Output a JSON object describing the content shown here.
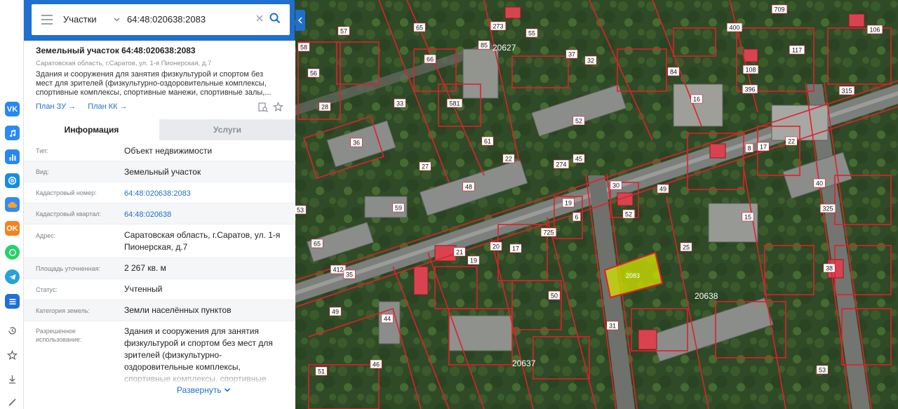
{
  "search": {
    "mode": "Участки",
    "query": "64:48:020638:2083"
  },
  "parcel": {
    "title": "Земельный участок 64:48:020638:2083",
    "address_short": "Саратовская область, г.Саратов, ул. 1-я Пионерская, д.7",
    "usage_short": "Здания и сооружения для занятия физкультурой и спортом без мест для зрителей (физкультурно-оздоровительные комплексы, спортивные комплексы, спортивные манежи, спортивные залы,...",
    "link_zu": "План ЗУ →",
    "link_kk": "План КК →"
  },
  "tabs": {
    "info": "Информация",
    "services": "Услуги"
  },
  "info": {
    "type_label": "Тип:",
    "type_value": "Объект недвижимости",
    "kind_label": "Вид:",
    "kind_value": "Земельный участок",
    "cad_num_label": "Кадастровый номер:",
    "cad_num_value": "64:48:020638:2083",
    "cad_block_label": "Кадастровый квартал:",
    "cad_block_value": "64:48:020638",
    "address_label": "Адрес:",
    "address_value": "Саратовская область, г.Саратов, ул. 1-я Пионерская, д.7",
    "area_label": "Площадь уточненная:",
    "area_value": "2 267 кв. м",
    "status_label": "Статус:",
    "status_value": "Учтенный",
    "category_label": "Категория земель:",
    "category_value": "Земли населённых пунктов",
    "permitted_label": "Разрешенное использование:",
    "permitted_value": "Здания и сооружения для занятия физкультурой и спортом без мест для зрителей (физкультурно-оздоровительные комплексы, спортивные комплексы, спортивные",
    "expand": "Развернуть"
  },
  "social": {
    "vk": "VK",
    "ok": "OK"
  },
  "map": {
    "parcel_label": "2083",
    "block_labels": [
      "20627",
      "20638",
      "20637"
    ],
    "house_numbers": [
      "57",
      "65",
      "66",
      "58",
      "56",
      "28",
      "33",
      "581",
      "61",
      "36",
      "27",
      "59",
      "53",
      "65",
      "48",
      "85",
      "273",
      "55",
      "52",
      "32",
      "37",
      "84",
      "16",
      "274",
      "45",
      "52",
      "30",
      "49",
      "19",
      "52",
      "725",
      "25",
      "15",
      "40",
      "325",
      "22",
      "17",
      "53",
      "38",
      "412",
      "35",
      "19",
      "21",
      "17",
      "20",
      "22",
      "8",
      "6",
      "50",
      "49",
      "31",
      "44",
      "46",
      "51",
      "400",
      "709",
      "106",
      "117",
      "108",
      "396",
      "315"
    ],
    "parcel_color": "#d4e600"
  }
}
